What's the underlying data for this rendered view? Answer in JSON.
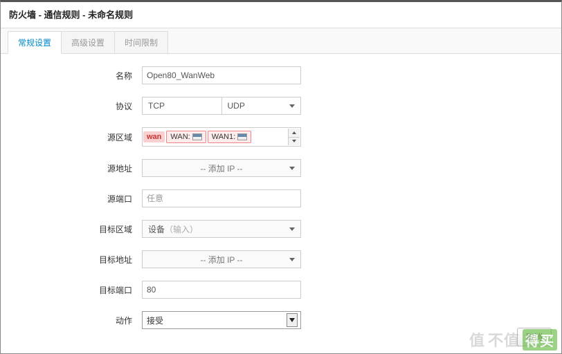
{
  "title": "防火墙 - 通信规则 - 未命名规则",
  "tabs": {
    "general": "常规设置",
    "advanced": "高级设置",
    "time": "时间限制"
  },
  "labels": {
    "name": "名称",
    "protocol": "协议",
    "src_zone": "源区域",
    "src_addr": "源地址",
    "src_port": "源端口",
    "dst_zone": "目标区域",
    "dst_addr": "目标地址",
    "dst_port": "目标端口",
    "action": "动作"
  },
  "values": {
    "name": "Open80_WanWeb",
    "protocol_main": "TCP",
    "protocol_alt": "UDP",
    "src_zone_group": "wan",
    "src_zone_tags": [
      "WAN:",
      "WAN1:"
    ],
    "add_ip": "-- 添加 IP --",
    "src_port_placeholder": "任意",
    "dst_zone": "设备",
    "dst_zone_hint": "（输入）",
    "dst_port": "80",
    "action": "接受"
  },
  "footer": {
    "cancel": "取消"
  },
  "watermark": {
    "left": "值",
    "mid": "不值",
    "badge": "得买"
  }
}
